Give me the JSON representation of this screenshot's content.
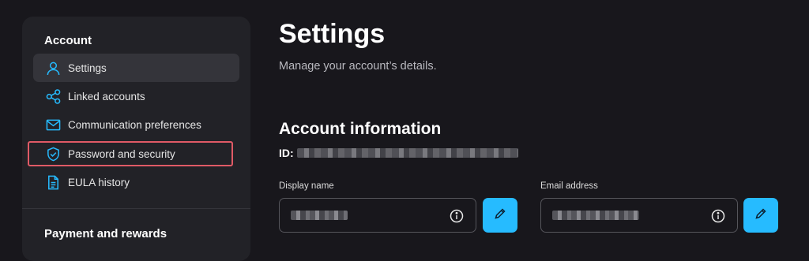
{
  "sidebar": {
    "account_heading": "Account",
    "items": [
      {
        "label": "Settings",
        "icon": "user-icon",
        "active": true
      },
      {
        "label": "Linked accounts",
        "icon": "share-icon",
        "active": false
      },
      {
        "label": "Communication preferences",
        "icon": "mail-icon",
        "active": false
      },
      {
        "label": "Password and security",
        "icon": "shield-icon",
        "active": false
      },
      {
        "label": "EULA history",
        "icon": "document-icon",
        "active": false
      }
    ],
    "payment_heading": "Payment and rewards"
  },
  "main": {
    "title": "Settings",
    "subtitle": "Manage your account’s details.",
    "section_title": "Account information",
    "id_label": "ID:",
    "display_name": {
      "label": "Display name"
    },
    "email": {
      "label": "Email address"
    }
  },
  "colors": {
    "accent": "#26bbff",
    "highlight": "#e05a66",
    "background": "#18171c",
    "sidebar": "#222227"
  }
}
